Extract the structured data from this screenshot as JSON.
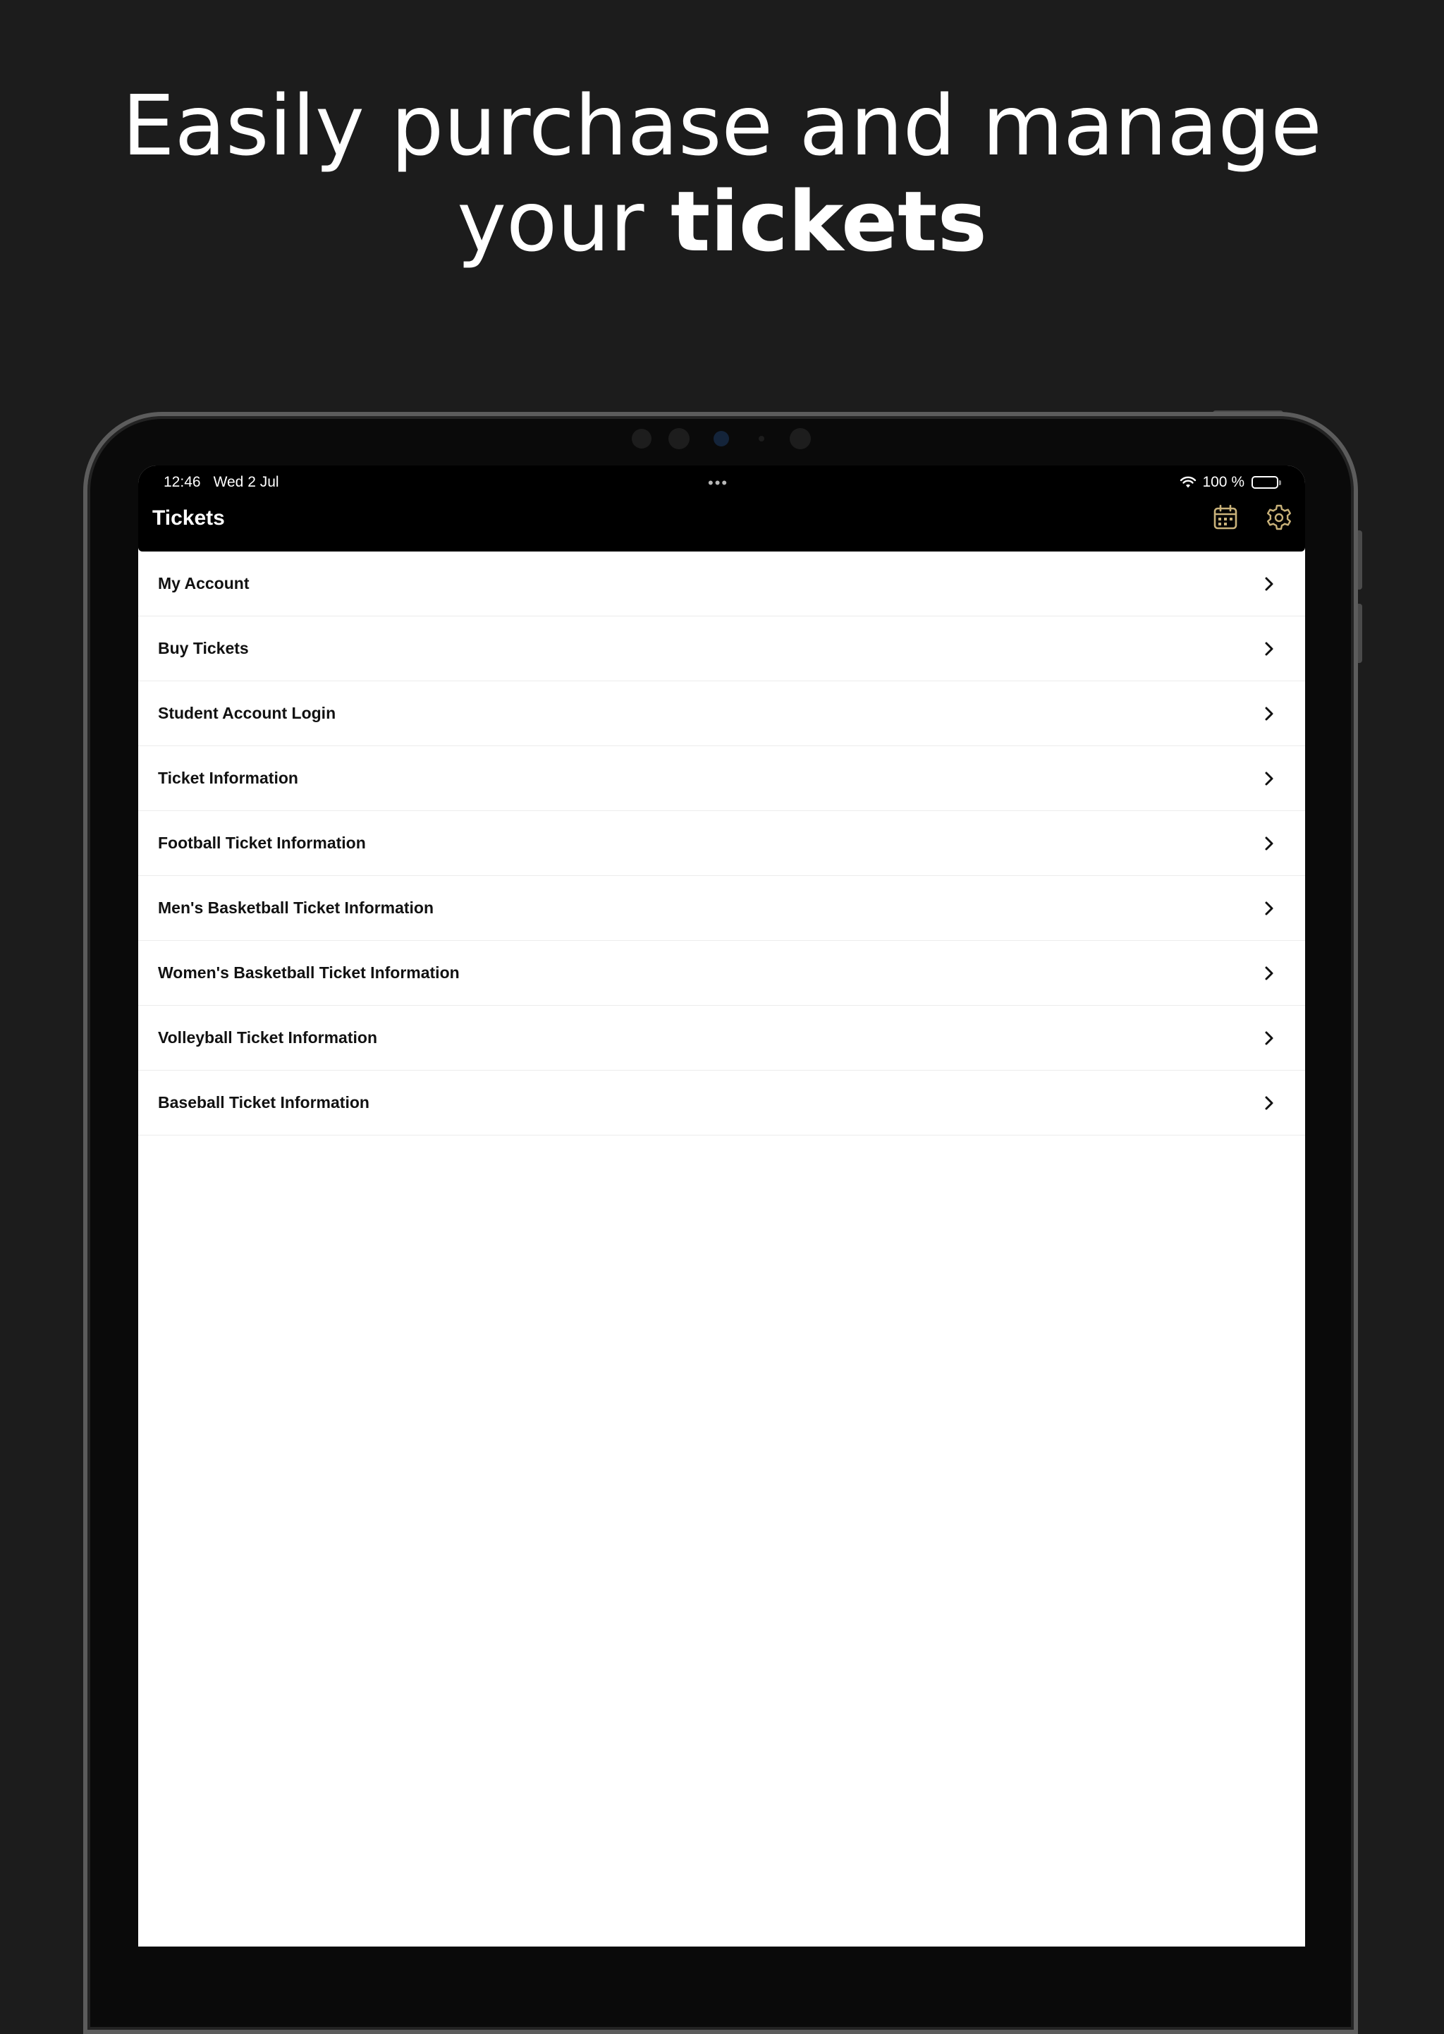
{
  "promo": {
    "line1": "Easily purchase and manage",
    "line2_prefix": "your ",
    "line2_bold": "tickets"
  },
  "status_bar": {
    "time": "12:46",
    "date": "Wed 2 Jul",
    "battery": "100 %"
  },
  "nav": {
    "title": "Tickets",
    "calendar_icon": "calendar-icon",
    "settings_icon": "gear-icon"
  },
  "menu": {
    "items": [
      {
        "label": "My Account"
      },
      {
        "label": "Buy Tickets"
      },
      {
        "label": "Student Account Login"
      },
      {
        "label": "Ticket Information"
      },
      {
        "label": "Football Ticket Information"
      },
      {
        "label": "Men's Basketball Ticket Information"
      },
      {
        "label": "Women's Basketball Ticket Information"
      },
      {
        "label": "Volleyball Ticket Information"
      },
      {
        "label": "Baseball Ticket Information"
      }
    ]
  },
  "colors": {
    "background": "#1c1c1c",
    "nav_bar": "#000000",
    "accent_icon": "#c9b27a",
    "row_text": "#111111"
  }
}
